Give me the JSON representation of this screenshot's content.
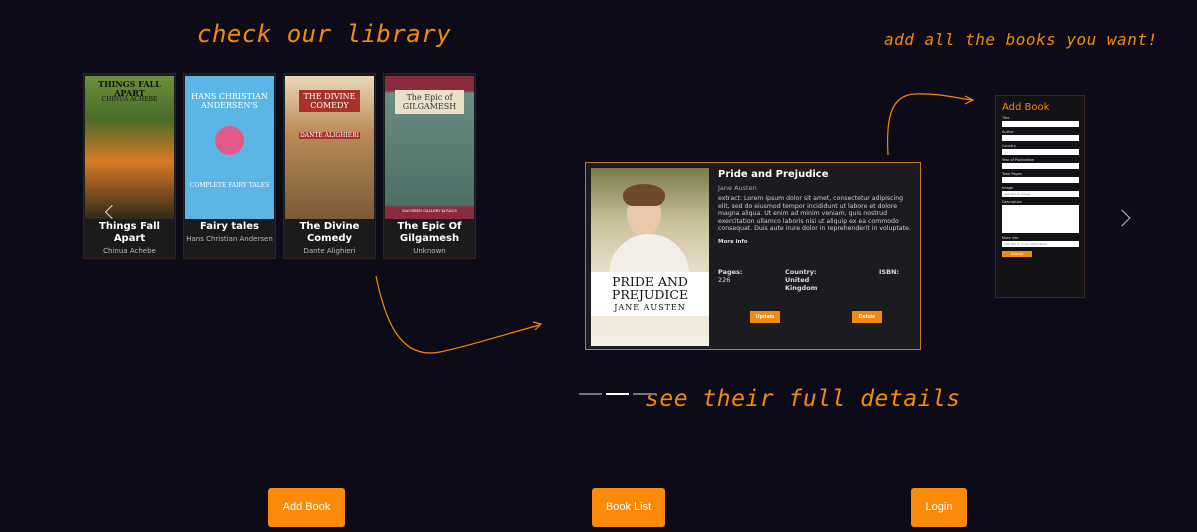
{
  "annotations": {
    "library": "check our library",
    "add": "add all the books you want!",
    "details": "see their full details"
  },
  "library": {
    "books": [
      {
        "title": "Things Fall Apart",
        "author": "Chinua Achebe",
        "cover_title": "THINGS FALL APART",
        "cover_sub": "CHINUA ACHEBE"
      },
      {
        "title": "Fairy tales",
        "author": "Hans Christian Andersen",
        "cover_title": "HANS CHRISTIAN ANDERSEN'S",
        "cover_sub": "COMPLETE FAIRY TALES"
      },
      {
        "title": "The Divine Comedy",
        "author": "Dante Alighieri",
        "cover_title": "THE DIVINE COMEDY",
        "cover_sub": "DANTE ALIGHIERI"
      },
      {
        "title": "The Epic Of Gilgamesh",
        "author": "Unknown",
        "cover_title": "The Epic of GILGAMESH",
        "cover_sub": "MAUREEN GALLERY KOVACS"
      }
    ]
  },
  "detail": {
    "title": "Pride and Prejudice",
    "author": "Jane Austen",
    "extract": "extract: Lorem ipsum dolor sit amet, consectetur adipiscing elit, sed do eiusmod tempor incididunt ut labore et dolore magna aliqua. Ut enim ad minim veniam, quis nostrud exercitation ullamco laboris nisi ut aliquip ex ea commodo consequat. Duis aute irure dolor in reprehenderit in voluptate.",
    "more_info": "More info",
    "cover_title": "PRIDE AND PREJUDICE",
    "cover_author": "JANE AUSTEN",
    "pages_label": "Pages:",
    "pages_value": "226",
    "country_label": "Country:",
    "country_value": "United Kingdom",
    "isbn_label": "ISBN:",
    "update_label": "Update",
    "delete_label": "Delete"
  },
  "form": {
    "title": "Add Book",
    "fields": {
      "title": "Title",
      "author": "Author",
      "country": "Country",
      "year": "Year of Publication",
      "pages": "Total Pages",
      "image": "Image",
      "image_placeholder": "Add link to image",
      "description": "Description",
      "more_info": "More info",
      "more_info_placeholder": "Add link to more information"
    },
    "submit_label": "Submit"
  },
  "carousel": {
    "active_index": 1,
    "count": 3
  },
  "nav": {
    "add_book": "Add Book",
    "book_list": "Book List",
    "login": "Login"
  },
  "colors": {
    "accent": "#f28a0c",
    "background": "#0d0b17"
  }
}
